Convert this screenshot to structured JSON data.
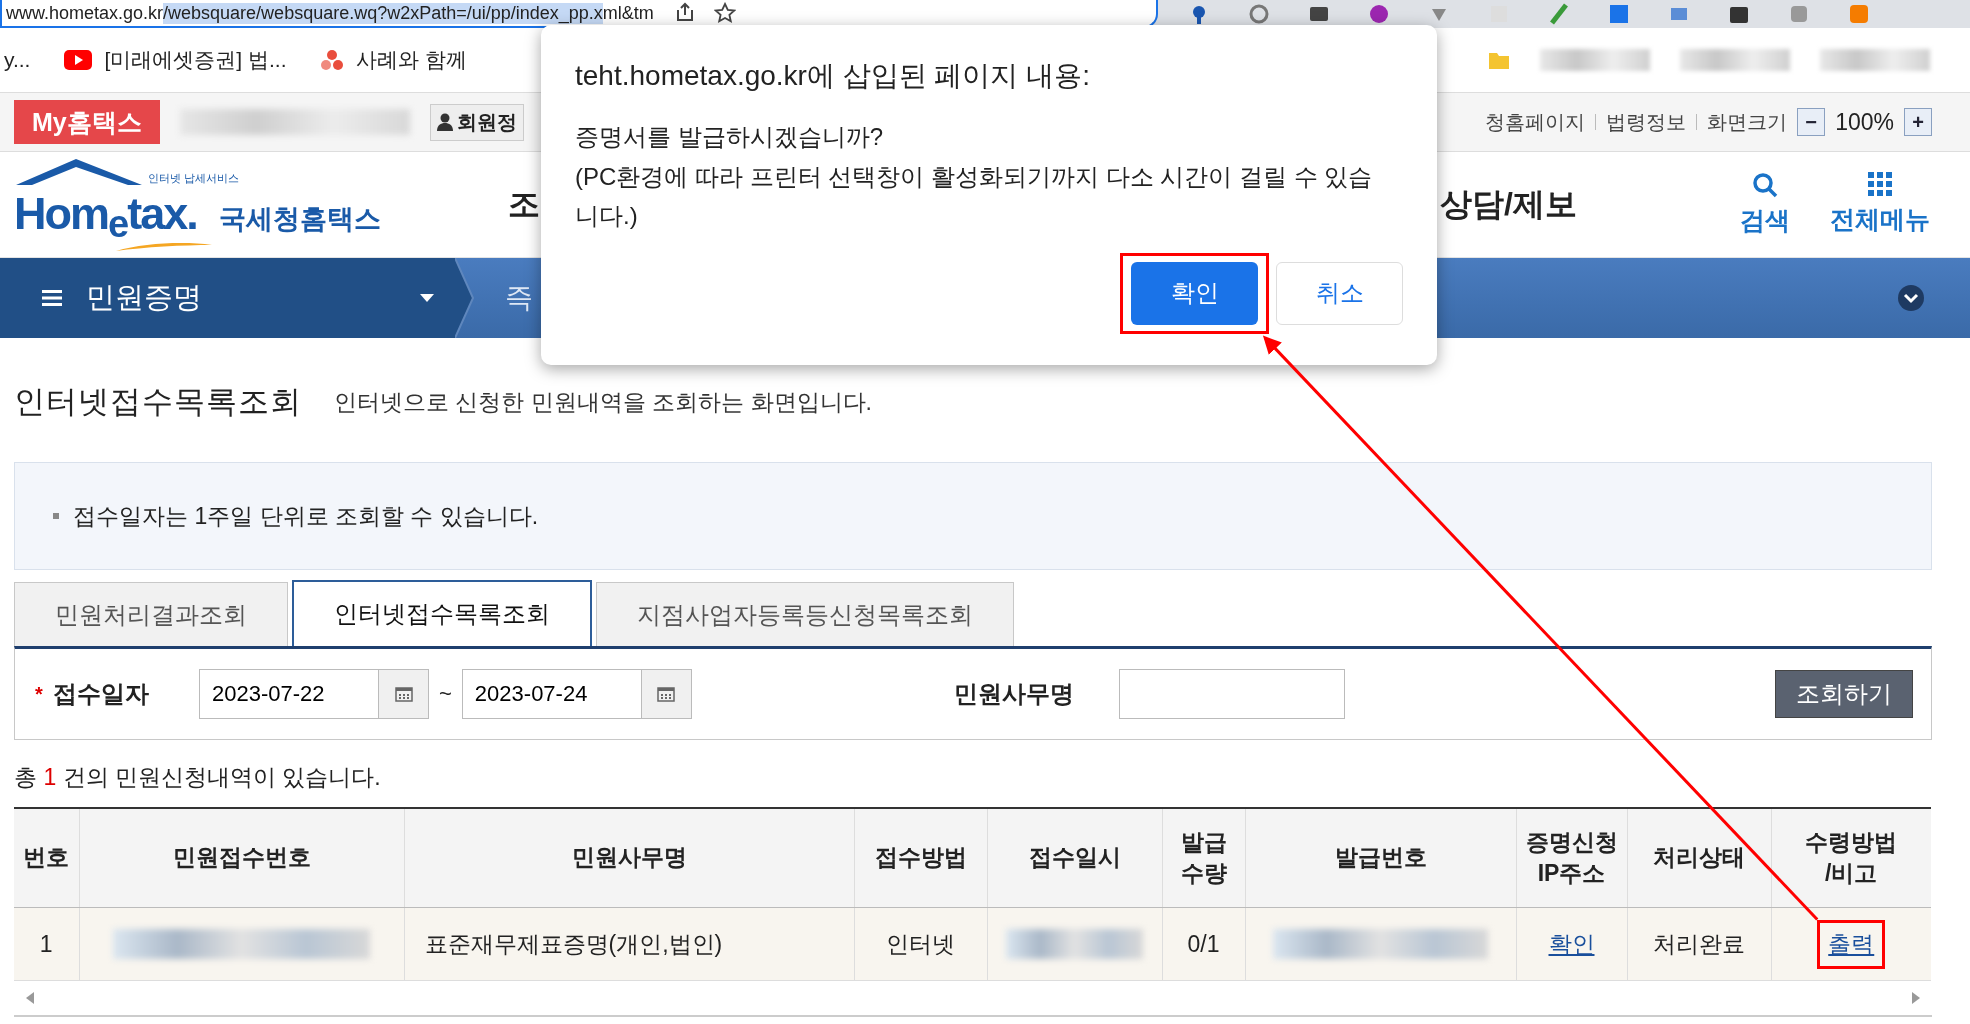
{
  "browser": {
    "url_parts": [
      {
        "text": "www.hometax.go.kr",
        "selected": false
      },
      {
        "text": "/websquare/websquare.wq?w2xPath=/ui/pp/index_pp.x",
        "selected": true
      },
      {
        "text": "ml&tm",
        "selected": false
      }
    ],
    "bookmarks": [
      {
        "label": "y...",
        "kind": "plain"
      },
      {
        "label": "[미래에셋증권] 법...",
        "kind": "video"
      },
      {
        "label": "사례와 함께",
        "kind": "dots"
      }
    ]
  },
  "topbar": {
    "my_button": "My홈택스",
    "member": "회원정",
    "links": [
      "청홈페이지",
      "법령정보",
      "화면크기"
    ],
    "zoom_minus": "−",
    "zoom_value": "100%",
    "zoom_plus": "+"
  },
  "header": {
    "logo_small": "인터넷 납세서비스",
    "logo_main": "Hom$_{e}$tax.",
    "logo_sub": "국세청홈택스",
    "menu": [
      "조",
      "상담/제보"
    ],
    "tools": [
      {
        "label": "검색",
        "kind": "search"
      },
      {
        "label": "전체메뉴",
        "kind": "grid"
      }
    ]
  },
  "nav": {
    "menu_label": "민원증명",
    "crumb": "즉"
  },
  "page": {
    "title": "인터넷접수목록조회",
    "description": "인터넷으로 신청한 민원내역을 조회하는 화면입니다.",
    "notice": "접수일자는 1주일 단위로 조회할 수 있습니다."
  },
  "tabs": [
    {
      "label": "민원처리결과조회",
      "selected": false
    },
    {
      "label": "인터넷접수목록조회",
      "selected": true
    },
    {
      "label": "지점사업자등록등신청목록조회",
      "selected": false
    }
  ],
  "search": {
    "required_mark": "*",
    "date_label": "접수일자",
    "from": "2023-07-22",
    "separator": "~",
    "to": "2023-07-24",
    "name_label": "민원사무명",
    "button": "조회하기"
  },
  "summary": {
    "prefix": "총",
    "count": "1",
    "suffix": "건의 민원신청내역이 있습니다."
  },
  "table": {
    "columns": [
      "번호",
      "민원접수번호",
      "민원사무명",
      "접수방법",
      "접수일시",
      "발급\n수량",
      "발급번호",
      "증명신청\nIP주소",
      "처리상태",
      "수령방법\n/비고"
    ],
    "rows": [
      {
        "cells": [
          {
            "kind": "text",
            "text": "1"
          },
          {
            "kind": "blurred"
          },
          {
            "kind": "text",
            "text": "표준재무제표증명(개인,법인)"
          },
          {
            "kind": "text",
            "text": "인터넷"
          },
          {
            "kind": "blurred"
          },
          {
            "kind": "text",
            "text": "0/1"
          },
          {
            "kind": "blurred"
          },
          {
            "kind": "link",
            "text": "확인"
          },
          {
            "kind": "text",
            "text": "처리완료"
          },
          {
            "kind": "link",
            "text": "출력",
            "highlighted": true
          }
        ]
      }
    ]
  },
  "dialog": {
    "title": "teht.hometax.go.kr에 삽입된 페이지 내용:",
    "message": "증명서를 발급하시겠습니까?\n(PC환경에 따라 프린터 선택창이 활성화되기까지 다소 시간이 걸릴 수 있습니다.)",
    "buttons": [
      {
        "label": "확인",
        "primary": true,
        "highlighted": true
      },
      {
        "label": "취소",
        "primary": false,
        "highlighted": false
      }
    ]
  }
}
